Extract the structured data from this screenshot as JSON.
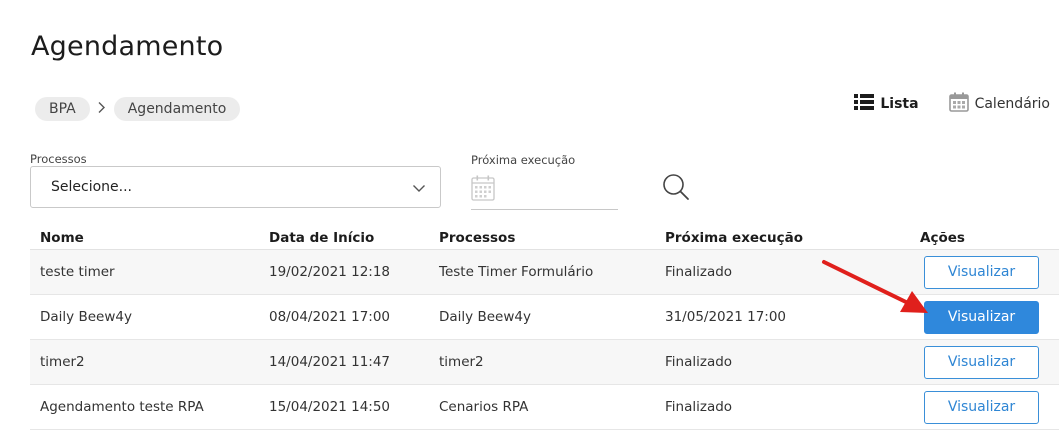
{
  "page": {
    "title": "Agendamento"
  },
  "breadcrumb": [
    "BPA",
    "Agendamento"
  ],
  "view_switch": {
    "list_label": "Lista",
    "calendar_label": "Calendário"
  },
  "filters": {
    "processes_label": "Processos",
    "processes_value": "Selecione...",
    "next_exec_label": "Próxima execução"
  },
  "table": {
    "headers": [
      "Nome",
      "Data de Início",
      "Processos",
      "Próxima execução",
      "Ações"
    ],
    "rows": [
      {
        "nome": "teste timer",
        "data_inicio": "19/02/2021 12:18",
        "processos": "Teste Timer Formulário",
        "proxima": "Finalizado",
        "acao": "Visualizar"
      },
      {
        "nome": "Daily Beew4y",
        "data_inicio": "08/04/2021 17:00",
        "processos": "Daily Beew4y",
        "proxima": "31/05/2021 17:00",
        "acao": "Visualizar"
      },
      {
        "nome": "timer2",
        "data_inicio": "14/04/2021 11:47",
        "processos": "timer2",
        "proxima": "Finalizado",
        "acao": "Visualizar"
      },
      {
        "nome": "Agendamento teste RPA",
        "data_inicio": "15/04/2021 14:50",
        "processos": "Cenarios RPA",
        "proxima": "Finalizado",
        "acao": "Visualizar"
      }
    ]
  },
  "colors": {
    "accent": "#2f88dc",
    "annotation_arrow": "#e0201c"
  },
  "icons": [
    "list-icon",
    "calendar-icon",
    "chevron-down-icon",
    "calendar-grid-icon",
    "search-icon",
    "arrow-annotation-icon"
  ]
}
